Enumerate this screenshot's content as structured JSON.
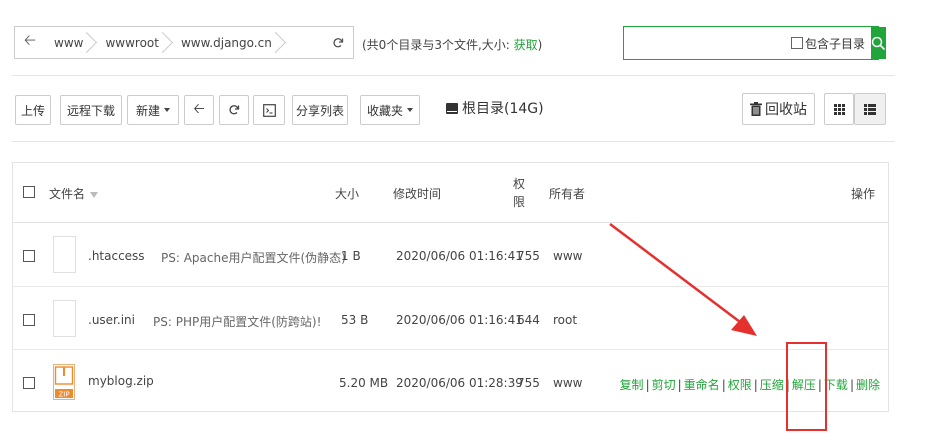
{
  "path": {
    "back_icon": "arrow-left-icon",
    "crumbs": [
      "www",
      "wwwroot",
      "www.django.cn"
    ],
    "refresh_icon": "refresh-icon",
    "info_text": "(共0个目录与3个文件,大小: ",
    "info_fetch": "获取",
    "info_close": ")"
  },
  "search": {
    "value": "",
    "placeholder": "",
    "subdir_label": "包含子目录",
    "button_icon": "search-icon"
  },
  "toolbar": {
    "upload": "上传",
    "remote_download": "远程下载",
    "new": "新建",
    "back_icon": "arrow-left-icon",
    "refresh_icon": "refresh-icon",
    "terminal_icon": "terminal-icon",
    "share_list": "分享列表",
    "favorites": "收藏夹",
    "root_dir": "根目录(14G)",
    "recycle_bin": "回收站",
    "grid_view_icon": "grid-view-icon",
    "list_view_icon": "list-view-icon"
  },
  "table": {
    "headers": {
      "name": "文件名",
      "size": "大小",
      "mtime": "修改时间",
      "perm_1": "权",
      "perm_2": "限",
      "owner": "所有者",
      "ops": "操作"
    },
    "rows": [
      {
        "name": ".htaccess",
        "remark": "PS: Apache用户配置文件(伪静态)",
        "size": "1 B",
        "mtime": "2020/06/06 01:16:41",
        "perm": "755",
        "owner": "www",
        "icon": "file-icon"
      },
      {
        "name": ".user.ini",
        "remark": "PS: PHP用户配置文件(防跨站)!",
        "size": "53 B",
        "mtime": "2020/06/06 01:16:41",
        "perm": "644",
        "owner": "root",
        "icon": "file-icon"
      },
      {
        "name": "myblog.zip",
        "remark": "",
        "size": "5.20 MB",
        "mtime": "2020/06/06 01:28:39",
        "perm": "755",
        "owner": "www",
        "icon": "zip-file-icon",
        "zip_badge": "ZIP"
      }
    ],
    "actions": [
      "复制",
      "剪切",
      "重命名",
      "权限",
      "压缩",
      "解压",
      "下载",
      "删除"
    ],
    "action_sep": "|"
  },
  "colors": {
    "accent": "#20a53a",
    "annotation_red": "#e5302e",
    "zip_orange": "#ef8a2d"
  }
}
